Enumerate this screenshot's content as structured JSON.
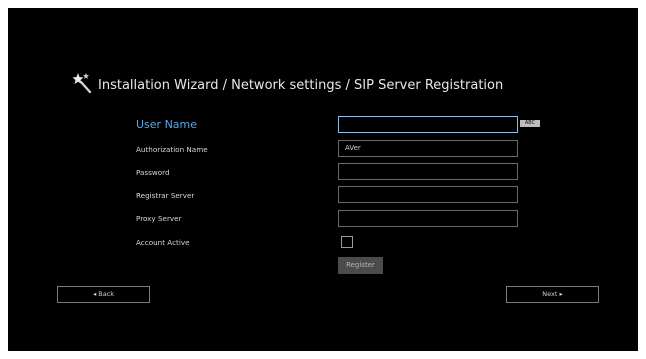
{
  "wizard": {
    "title": "Installation Wizard / Network settings / SIP Server Registration",
    "icon": "magic-wand-icon"
  },
  "form": {
    "user_name_label": "User Name",
    "user_name_value": "",
    "keyboard_badge": "ABC",
    "authorization_name_label": "Authorization Name",
    "authorization_name_value": "AVer",
    "password_label": "Password",
    "password_value": "",
    "registrar_server_label": "Registrar Server",
    "registrar_server_value": "",
    "proxy_server_label": "Proxy Server",
    "proxy_server_value": "",
    "account_active_label": "Account Active",
    "account_active_checked": false,
    "register_label": "Register"
  },
  "nav": {
    "back_label": "◂ Back",
    "next_label": "Next ▸"
  },
  "colors": {
    "background": "#000000",
    "active_label": "#5aa6e6",
    "field_border": "#6a6a6a"
  }
}
